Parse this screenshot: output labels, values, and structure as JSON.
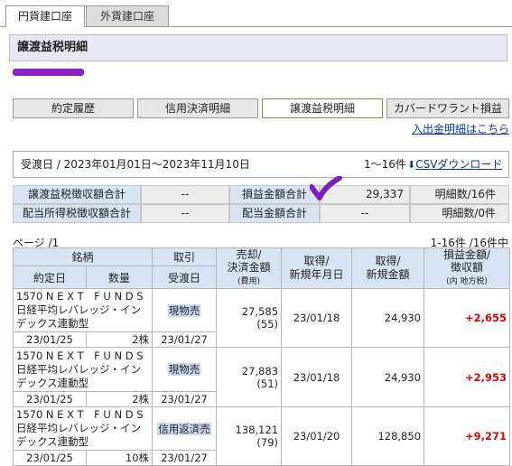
{
  "tabs": {
    "yen": "円貨建口座",
    "fx": "外貨建口座"
  },
  "page_title": "譲渡益税明細",
  "sub_buttons": [
    "約定履歴",
    "信用決済明細",
    "譲渡益税明細",
    "カバードワラント損益"
  ],
  "deposit_link": "入出金明細はこちら",
  "period": {
    "text": "受渡日 / 2023年01月01日〜2023年11月10日",
    "range": "1〜16件",
    "csv": "CSVダウンロード"
  },
  "summary": {
    "r1": {
      "label1": "譲渡益税徴収額合計",
      "val1": "--",
      "label2": "損益金額合計",
      "val2": "29,337",
      "count": "明細数/16件"
    },
    "r2": {
      "label1": "配当所得税徴収額合計",
      "val1": "--",
      "label2": "配当金額合計",
      "val2": "--",
      "count": "明細数/0件"
    }
  },
  "paging": {
    "page": "ページ /1",
    "count": "1-16件 /16件中"
  },
  "headers": {
    "meigara": "銘柄",
    "torihiki": "取引",
    "baikyaku1": "売却/",
    "baikyaku2": "決済金額",
    "baikyaku3": "(費用)",
    "shutoku1": "取得/",
    "shutoku2": "新規年月日",
    "shutokug1": "取得/",
    "shutokug2": "新規金額",
    "sonneki1": "損益金額/",
    "sonneki2": "徴収額",
    "sonneki3": "(内 地方税)",
    "yakujo": "約定日",
    "suryo": "数量",
    "ukewatashi": "受渡日"
  },
  "rows": [
    {
      "fund": "1570 N E X T　F U N D S 日経平均レバレッジ・インデックス連動型",
      "trade": "現物売",
      "amount": "27,585",
      "fee": "(55)",
      "acq_date": "23/01/18",
      "acq_amount": "24,930",
      "pl": "+2,655",
      "exec": "23/01/25",
      "qty": "2株",
      "settle": "23/01/27"
    },
    {
      "fund": "1570 N E X T　F U N D S 日経平均レバレッジ・インデックス連動型",
      "trade": "現物売",
      "amount": "27,883",
      "fee": "(51)",
      "acq_date": "23/01/18",
      "acq_amount": "24,930",
      "pl": "+2,953",
      "exec": "23/01/25",
      "qty": "2株",
      "settle": "23/01/27"
    },
    {
      "fund": "1570 N E X T　F U N D S 日経平均レバレッジ・インデックス連動型",
      "trade": "信用返済売",
      "amount": "138,121",
      "fee": "(79)",
      "acq_date": "23/01/20",
      "acq_amount": "128,850",
      "pl": "+9,271",
      "exec": "23/01/25",
      "qty": "10株",
      "settle": "23/01/27"
    }
  ],
  "colors": {
    "header_bg": "#d6e4f4",
    "profit": "#e60000",
    "check": "#7b1fbe"
  }
}
